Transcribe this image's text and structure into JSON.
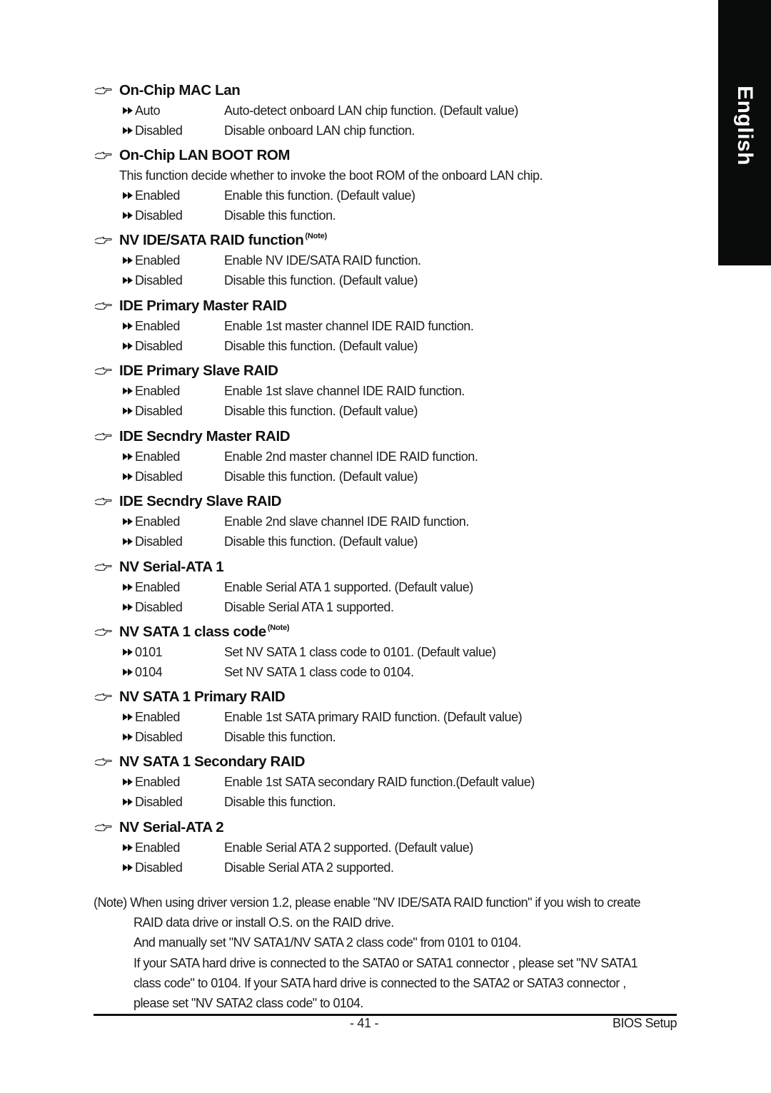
{
  "language_tab": "English",
  "sections": [
    {
      "title": "On-Chip MAC Lan",
      "note": "",
      "description": "",
      "options": [
        {
          "label": "Auto",
          "text": "Auto-detect onboard LAN chip function. (Default value)"
        },
        {
          "label": "Disabled",
          "text": "Disable onboard LAN chip function."
        }
      ]
    },
    {
      "title": "On-Chip LAN BOOT ROM",
      "note": "",
      "description": "This function decide whether to invoke the boot ROM of the onboard LAN chip.",
      "options": [
        {
          "label": "Enabled",
          "text": "Enable this function. (Default value)"
        },
        {
          "label": "Disabled",
          "text": "Disable this function."
        }
      ]
    },
    {
      "title": "NV IDE/SATA RAID function",
      "note": "(Note)",
      "description": "",
      "options": [
        {
          "label": "Enabled",
          "text": "Enable NV IDE/SATA RAID function."
        },
        {
          "label": "Disabled",
          "text": "Disable this function. (Default value)"
        }
      ]
    },
    {
      "title": "IDE Primary Master RAID",
      "note": "",
      "description": "",
      "options": [
        {
          "label": "Enabled",
          "text": "Enable 1st master channel IDE RAID function."
        },
        {
          "label": "Disabled",
          "text": "Disable this function. (Default value)"
        }
      ]
    },
    {
      "title": "IDE Primary Slave RAID",
      "note": "",
      "description": "",
      "options": [
        {
          "label": "Enabled",
          "text": "Enable 1st slave channel IDE RAID function."
        },
        {
          "label": "Disabled",
          "text": "Disable this function. (Default value)"
        }
      ]
    },
    {
      "title": "IDE Secndry Master RAID",
      "note": "",
      "description": "",
      "options": [
        {
          "label": "Enabled",
          "text": "Enable 2nd master channel IDE RAID function."
        },
        {
          "label": "Disabled",
          "text": "Disable this function. (Default value)"
        }
      ]
    },
    {
      "title": "IDE Secndry Slave RAID",
      "note": "",
      "description": "",
      "options": [
        {
          "label": "Enabled",
          "text": "Enable 2nd slave channel IDE RAID function."
        },
        {
          "label": "Disabled",
          "text": "Disable this function. (Default value)"
        }
      ]
    },
    {
      "title": "NV Serial-ATA 1",
      "note": "",
      "description": "",
      "options": [
        {
          "label": "Enabled",
          "text": "Enable Serial ATA 1 supported. (Default value)"
        },
        {
          "label": "Disabled",
          "text": "Disable Serial ATA 1 supported."
        }
      ]
    },
    {
      "title": "NV SATA 1 class code",
      "note": "(Note)",
      "description": "",
      "options": [
        {
          "label": "0101",
          "text": "Set NV SATA 1 class code to 0101. (Default value)"
        },
        {
          "label": "0104",
          "text": "Set NV SATA 1 class code to 0104."
        }
      ]
    },
    {
      "title": "NV SATA 1 Primary RAID",
      "note": "",
      "description": "",
      "options": [
        {
          "label": "Enabled",
          "text": "Enable 1st SATA primary RAID function. (Default value)"
        },
        {
          "label": "Disabled",
          "text": "Disable this function."
        }
      ]
    },
    {
      "title": "NV SATA 1 Secondary RAID",
      "note": "",
      "description": "",
      "options": [
        {
          "label": "Enabled",
          "text": "Enable 1st SATA secondary RAID function.(Default value)"
        },
        {
          "label": "Disabled",
          "text": "Disable this function."
        }
      ]
    },
    {
      "title": "NV Serial-ATA 2",
      "note": "",
      "description": "",
      "options": [
        {
          "label": "Enabled",
          "text": "Enable Serial ATA 2 supported. (Default value)"
        },
        {
          "label": "Disabled",
          "text": "Disable Serial ATA 2 supported."
        }
      ]
    }
  ],
  "footnote": {
    "lines": [
      "(Note) When using driver version 1.2, please enable \"NV IDE/SATA RAID function\" if you wish to create",
      "RAID data drive or install O.S. on the RAID drive.",
      "And manually set \"NV SATA1/NV SATA 2 class code\" from 0101 to 0104.",
      "If your SATA hard drive is connected  to the SATA0 or SATA1 connector , please set  \"NV SATA1",
      "class code\" to 0104. If your SATA hard drive is connected  to the SATA2 or SATA3 connector ,",
      "please set \"NV SATA2 class code\" to 0104."
    ]
  },
  "footer": {
    "page_number": "- 41 -",
    "chapter_title": "BIOS Setup"
  },
  "icons": {
    "section_marker": "pointing-hand-icon",
    "option_marker": "double-arrow-icon"
  }
}
